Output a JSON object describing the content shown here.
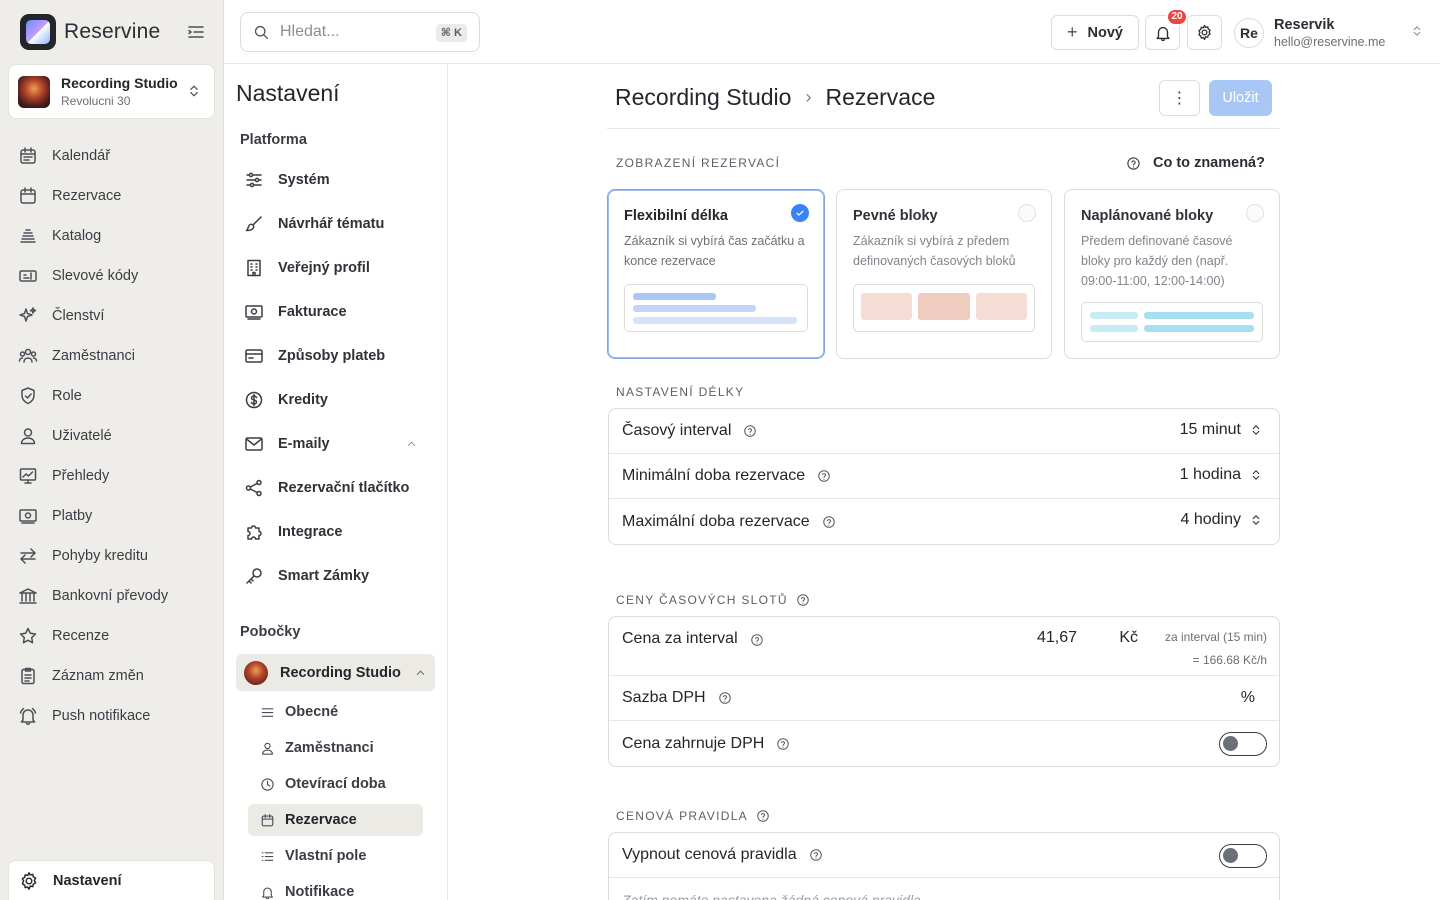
{
  "brand": {
    "name": "Reservine"
  },
  "studio": {
    "name": "Recording Studio",
    "address": "Revolucni 30"
  },
  "nav": [
    {
      "label": "Kalendář",
      "icon": "calendar-icon"
    },
    {
      "label": "Rezervace",
      "icon": "calendar-check-icon"
    },
    {
      "label": "Katalog",
      "icon": "catalog-icon"
    },
    {
      "label": "Slevové kódy",
      "icon": "ticket-icon"
    },
    {
      "label": "Členství",
      "icon": "sparkles-icon"
    },
    {
      "label": "Zaměstnanci",
      "icon": "users-icon"
    },
    {
      "label": "Role",
      "icon": "shield-icon"
    },
    {
      "label": "Uživatelé",
      "icon": "user-icon"
    },
    {
      "label": "Přehledy",
      "icon": "chart-icon"
    },
    {
      "label": "Platby",
      "icon": "money-icon"
    },
    {
      "label": "Pohyby kreditu",
      "icon": "arrows-icon"
    },
    {
      "label": "Bankovní převody",
      "icon": "bank-icon"
    },
    {
      "label": "Recenze",
      "icon": "star-icon"
    },
    {
      "label": "Záznam změn",
      "icon": "clipboard-icon"
    },
    {
      "label": "Push notifikace",
      "icon": "bell-ring-icon"
    }
  ],
  "nav_bottom": {
    "label": "Nastavení",
    "icon": "gear-icon"
  },
  "topbar": {
    "search_placeholder": "Hledat...",
    "search_shortcut": "⌘ K",
    "new_label": "Nový",
    "notifications_count": "20",
    "user_initials": "Re",
    "user_name": "Reservik",
    "user_email": "hello@reservine.me"
  },
  "settings_nav": {
    "title": "Nastavení",
    "platform_label": "Platforma",
    "items": [
      {
        "label": "Systém",
        "icon": "sliders-icon"
      },
      {
        "label": "Návrhář tématu",
        "icon": "brush-icon"
      },
      {
        "label": "Veřejný profil",
        "icon": "building-icon"
      },
      {
        "label": "Fakturace",
        "icon": "invoice-icon"
      },
      {
        "label": "Způsoby plateb",
        "icon": "credit-card-icon"
      },
      {
        "label": "Kredity",
        "icon": "dollar-icon"
      },
      {
        "label": "E-maily",
        "icon": "mail-icon"
      },
      {
        "label": "Rezervační tlačítko",
        "icon": "share-icon"
      },
      {
        "label": "Integrace",
        "icon": "puzzle-icon"
      },
      {
        "label": "Smart Zámky",
        "icon": "key-icon"
      }
    ],
    "branches_label": "Pobočky",
    "branch_name": "Recording Studio",
    "sub_items": [
      {
        "label": "Obecné",
        "icon": "sliders-icon"
      },
      {
        "label": "Zaměstnanci",
        "icon": "user-icon"
      },
      {
        "label": "Otevírací doba",
        "icon": "clock-icon"
      },
      {
        "label": "Rezervace",
        "icon": "calendar-icon"
      },
      {
        "label": "Vlastní pole",
        "icon": "list-icon"
      },
      {
        "label": "Notifikace",
        "icon": "bell-icon"
      }
    ]
  },
  "main": {
    "breadcrumb": [
      "Recording Studio",
      "Rezervace"
    ],
    "more_label": "⋮",
    "save_label": "Uložit",
    "display_section": "ZOBRAZENÍ REZERVACÍ",
    "help_link": "Co to znamená?",
    "modes": [
      {
        "title": "Flexibilní délka",
        "desc": "Zákazník si vybírá čas začátku a konce rezervace",
        "selected": true
      },
      {
        "title": "Pevné bloky",
        "desc": "Zákazník si vybírá z předem definovaných časových bloků",
        "selected": false
      },
      {
        "title": "Naplánované bloky",
        "desc": "Předem definované časové bloky pro každý den (např. 09:00-11:00, 12:00-14:00)",
        "selected": false
      }
    ],
    "length_section": "NASTAVENÍ DÉLKY",
    "length_rows": [
      {
        "label": "Časový interval",
        "value": "15 minut"
      },
      {
        "label": "Minimální doba rezervace",
        "value": "1 hodina"
      },
      {
        "label": "Maximální doba rezervace",
        "value": "4 hodiny"
      }
    ],
    "prices_section": "CENY ČASOVÝCH SLOTŮ",
    "price_label": "Cena za interval",
    "price_value": "41,67",
    "price_unit": "Kč",
    "price_note1": "za interval (15 min)",
    "price_note2": "= 166.68 Kč/h",
    "vat_label": "Sazba DPH",
    "vat_value": "",
    "vat_unit": "%",
    "vat_included_label": "Cena zahrnuje DPH",
    "vat_included": false,
    "rules_section": "CENOVÁ PRAVIDLA",
    "rules_toggle_label": "Vypnout cenová pravidla",
    "rules_disabled": false,
    "rules_empty": "Zatím nemáte nastavena žádná cenová pravidla"
  },
  "colors": {
    "accent": "#3b82f6",
    "save_disabled": "#a9c7f5",
    "sidebar_bg": "#eeede9",
    "badge": "#ef4444"
  }
}
